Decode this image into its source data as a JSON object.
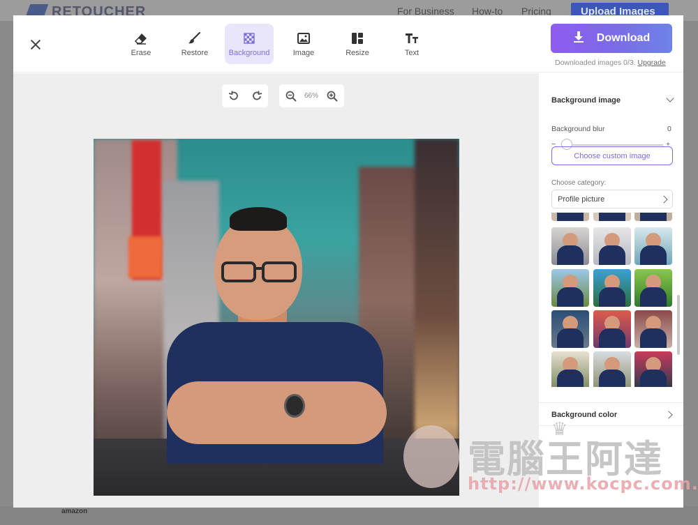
{
  "background_site": {
    "logo": "RETOUCHER",
    "nav": [
      "For Business",
      "How-to",
      "Pricing"
    ],
    "upload_label": "Upload Images",
    "bottom_text": "amazon"
  },
  "toolbar": {
    "tools": [
      {
        "label": "Erase",
        "icon": "eraser-icon"
      },
      {
        "label": "Restore",
        "icon": "brush-icon"
      },
      {
        "label": "Background",
        "icon": "checkerboard-icon",
        "active": true
      },
      {
        "label": "Image",
        "icon": "image-icon"
      },
      {
        "label": "Resize",
        "icon": "layout-icon"
      },
      {
        "label": "Text",
        "icon": "text-size-icon"
      }
    ],
    "download_label": "Download",
    "download_note": "Downloaded images 0/3.",
    "upgrade_label": "Upgrade"
  },
  "canvas": {
    "zoom": "66%"
  },
  "panel": {
    "background_image_title": "Background image",
    "blur_label": "Background blur",
    "blur_value": "0",
    "minus": "−",
    "plus": "+",
    "choose_custom_label": "Choose custom image",
    "category_label": "Choose category:",
    "category_value": "Profile picture",
    "background_color_title": "Background color"
  },
  "watermark": {
    "title": "電腦王阿達",
    "url": "http://www.kocpc.com.tw"
  },
  "colors": {
    "accent": "#7b6ce6",
    "download_gradient_start": "#8e5cf0",
    "download_gradient_end": "#6d83e8"
  }
}
